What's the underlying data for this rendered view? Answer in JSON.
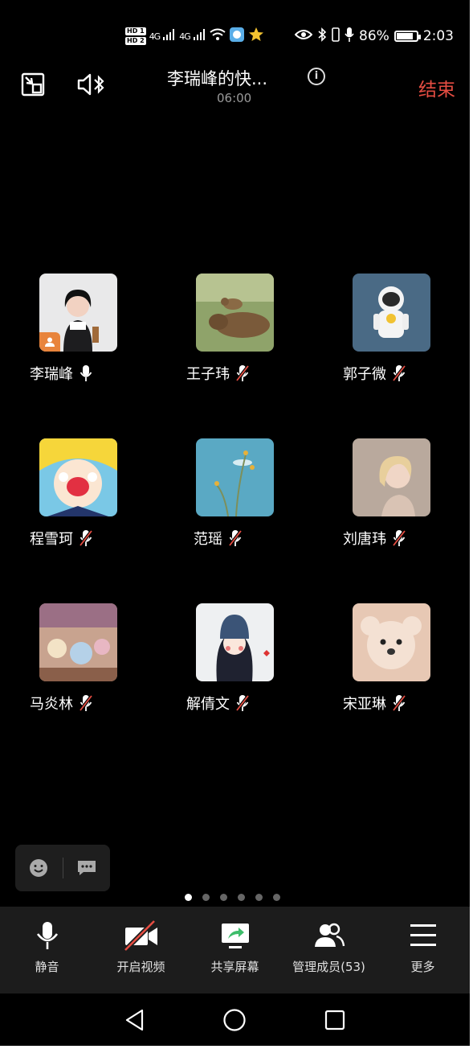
{
  "status": {
    "hd1": "HD 1",
    "hd2": "HD 2",
    "net1": "4G",
    "net2": "4G",
    "battery_text": "86%",
    "battery_level": 0.86,
    "time": "2:03"
  },
  "header": {
    "title": "李瑞峰的快...",
    "timer": "06:00",
    "end_label": "结束"
  },
  "participants": [
    {
      "name": "李瑞峰",
      "muted": false,
      "host": true,
      "avatar": "photo-woman"
    },
    {
      "name": "王子玮",
      "muted": true,
      "host": false,
      "avatar": "bears-grass"
    },
    {
      "name": "郭子微",
      "muted": true,
      "host": false,
      "avatar": "astronaut"
    },
    {
      "name": "程雪珂",
      "muted": true,
      "host": false,
      "avatar": "anime-girl"
    },
    {
      "name": "范瑶",
      "muted": true,
      "host": false,
      "avatar": "flowers-sky"
    },
    {
      "name": "刘唐玮",
      "muted": true,
      "host": false,
      "avatar": "blonde-portrait"
    },
    {
      "name": "马炎林",
      "muted": true,
      "host": false,
      "avatar": "toy-shelf"
    },
    {
      "name": "解倩文",
      "muted": true,
      "host": false,
      "avatar": "girl-drawing"
    },
    {
      "name": "宋亚琳",
      "muted": true,
      "host": false,
      "avatar": "plush-bear"
    }
  ],
  "pagination": {
    "total": 6,
    "active": 0
  },
  "toolbar": {
    "mute_label": "静音",
    "video_label": "开启视频",
    "share_label": "共享屏幕",
    "members_label": "管理成员(53)",
    "more_label": "更多"
  },
  "colors": {
    "end": "#e54d42",
    "toolbar_bg": "#1c1c1c",
    "share_green": "#3dbd6a"
  }
}
